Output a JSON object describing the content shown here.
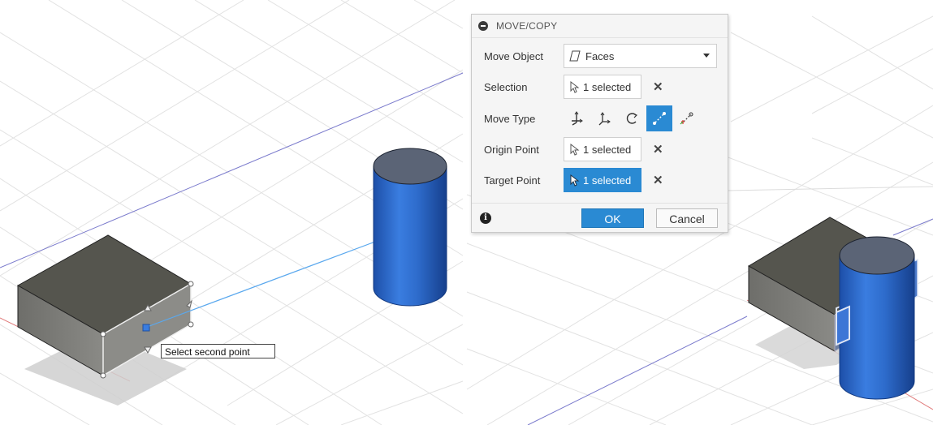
{
  "dialog": {
    "title": "MOVE/COPY",
    "move_object": {
      "label": "Move Object",
      "value": "Faces"
    },
    "selection": {
      "label": "Selection",
      "value": "1 selected"
    },
    "move_type": {
      "label": "Move Type",
      "options": [
        "free-move-icon",
        "translate-icon",
        "rotate-icon",
        "point-to-point-icon",
        "point-to-position-icon"
      ],
      "active": "point-to-point-icon"
    },
    "origin_point": {
      "label": "Origin Point",
      "value": "1 selected"
    },
    "target_point": {
      "label": "Target Point",
      "value": "1 selected"
    },
    "ok_label": "OK",
    "cancel_label": "Cancel"
  },
  "viewport": {
    "tooltip": "Select second point"
  },
  "colors": {
    "accent": "#2a8ad3",
    "cylinder": "#2a68c4",
    "box_side": "#757575",
    "box_top": "#5a5a52"
  }
}
